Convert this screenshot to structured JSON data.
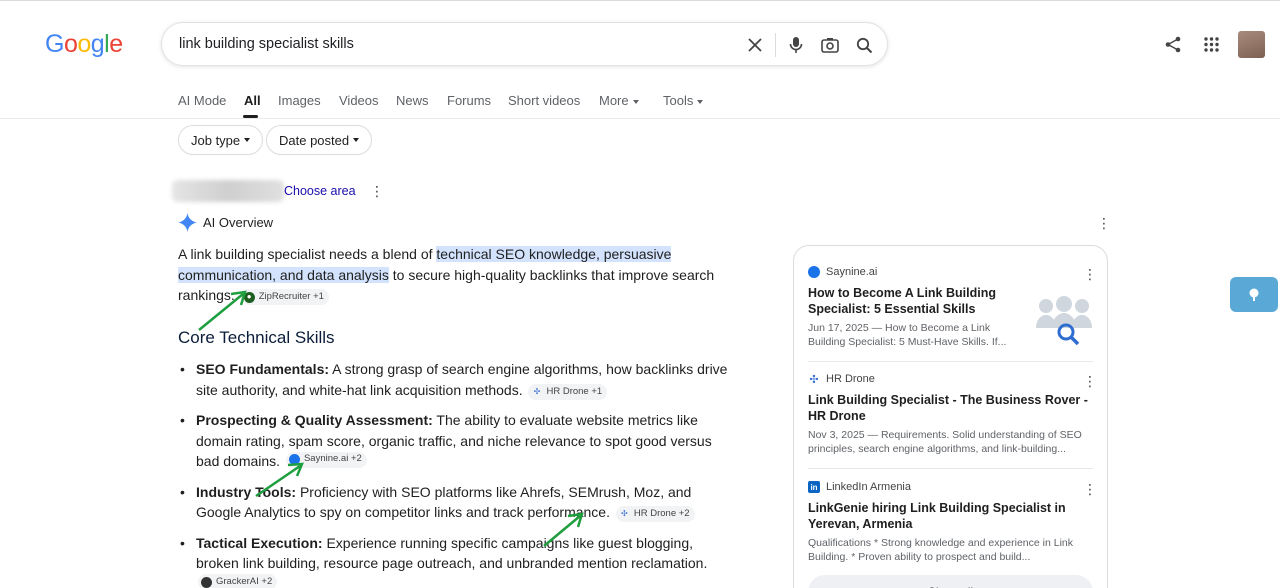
{
  "logo_letters": [
    "G",
    "o",
    "o",
    "g",
    "l",
    "e"
  ],
  "search": {
    "query": "link building specialist skills"
  },
  "tabs": [
    "AI Mode",
    "All",
    "Images",
    "Videos",
    "News",
    "Forums",
    "Short videos",
    "More",
    "Tools"
  ],
  "active_tab": "All",
  "filters": [
    "Job type",
    "Date posted"
  ],
  "choose_area": "Choose area",
  "ai_overview": {
    "label": "AI Overview",
    "intro_before": "A link building specialist needs a blend of ",
    "intro_highlight": "technical SEO knowledge, persuasive communication, and data analysis",
    "intro_after": " to secure high-quality backlinks that improve search rankings.",
    "intro_source": "ZipRecruiter +1",
    "heading": "Core Technical Skills",
    "bullets": [
      {
        "term": "SEO Fundamentals:",
        "text": " A strong grasp of search engine algorithms, how backlinks drive site authority, and white-hat link acquisition methods.",
        "source": "HR Drone +1"
      },
      {
        "term": "Prospecting & Quality Assessment:",
        "text": " The ability to evaluate website metrics like domain rating, spam score, organic traffic, and niche relevance to spot good versus bad domains.",
        "source": "Saynine.ai +2"
      },
      {
        "term": "Industry Tools:",
        "text": " Proficiency with SEO platforms like Ahrefs, SEMrush, Moz, and Google Analytics to spy on competitor links and track performance.",
        "source": "HR Drone +2"
      },
      {
        "term": "Tactical Execution:",
        "text": " Experience running specific campaigns like guest blogging, broken link building, resource page outreach, and unbranded mention reclamation.",
        "source": "GrackerAI +2"
      }
    ]
  },
  "sources_card": {
    "items": [
      {
        "site": "Saynine.ai",
        "title": "How to Become A Link Building Specialist: 5 Essential Skills",
        "snippet": "Jun 17, 2025 — How to Become a Link Building Specialist: 5 Must-Have Skills. If..."
      },
      {
        "site": "HR Drone",
        "title": "Link Building Specialist - The Business Rover - HR Drone",
        "snippet": "Nov 3, 2025 — Requirements. Solid understanding of SEO principles, search engine algorithms, and link-building..."
      },
      {
        "site": "LinkedIn Armenia",
        "title": "LinkGenie hiring Link Building Specialist in Yerevan, Armenia",
        "snippet": "Qualifications * Strong knowledge and experience in Link Building. * Proven ability to prospect and build..."
      }
    ],
    "show_all": "Show all"
  },
  "colors": {
    "highlight": "#d3e3fd",
    "link": "#1a0dab",
    "arrow": "#1e9e3e",
    "float_button": "#5aa8d6"
  }
}
